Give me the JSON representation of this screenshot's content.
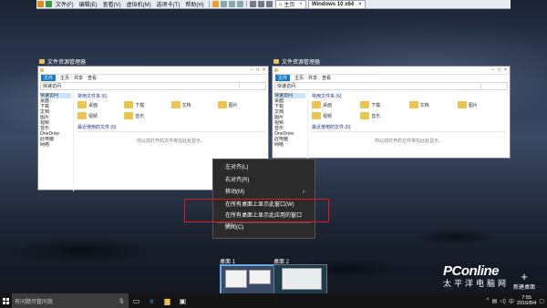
{
  "vmbar": {
    "menus": [
      "文件(F)",
      "编辑(E)",
      "查看(V)",
      "虚拟机(M)",
      "选项卡(T)",
      "帮助(H)"
    ],
    "tabs": [
      {
        "label": "主页",
        "active": false
      },
      {
        "label": "Windows 10 x64",
        "active": true
      }
    ]
  },
  "windows": [
    {
      "title": "文件资源管理器",
      "ribbon": [
        "文件",
        "主页",
        "共享",
        "查看"
      ],
      "address": "快速访问",
      "nav": [
        "快速访问",
        "桌面",
        "下载",
        "文档",
        "图片",
        "视频",
        "音乐",
        "OneDrive",
        "此电脑",
        "网络"
      ],
      "group_label": "常用文件夹 (6)",
      "folders": [
        "桌面",
        "下载",
        "文档",
        "图片",
        "视频",
        "音乐"
      ],
      "recent_label": "最近使用的文件 (0)",
      "empty_text": "你以前打开的文件将在此处显示。"
    },
    {
      "title": "文件资源管理器",
      "ribbon": [
        "文件",
        "主页",
        "共享",
        "查看"
      ],
      "address": "快速访问",
      "nav": [
        "快速访问",
        "桌面",
        "下载",
        "文档",
        "图片",
        "视频",
        "音乐",
        "OneDrive",
        "此电脑",
        "网络"
      ],
      "group_label": "常用文件夹 (6)",
      "folders": [
        "桌面",
        "下载",
        "文档",
        "图片",
        "视频",
        "音乐"
      ],
      "recent_label": "最近使用的文件 (0)",
      "empty_text": "你以前打开的文件将在此处显示。"
    }
  ],
  "context_menu": {
    "items": [
      "左对齐(L)",
      "右对齐(R)",
      "移动(M)",
      "在所有桌面上显示此窗口(W)",
      "在所有桌面上显示此应用的窗口(A)",
      "关闭(C)"
    ]
  },
  "task_view": {
    "desktops": [
      "桌面 1",
      "桌面 2"
    ],
    "new_desktop": "新建桌面"
  },
  "watermark": {
    "brand": "PConline",
    "sub": "太平洋电脑网"
  },
  "taskbar": {
    "search_placeholder": "有问题尽管问我",
    "time": "7:55",
    "date": "2016/8/4"
  },
  "colors": {
    "highlight_border": "#e0181f",
    "accent": "#1979ca",
    "desktop_thumb_active": "#6aa8e0"
  }
}
